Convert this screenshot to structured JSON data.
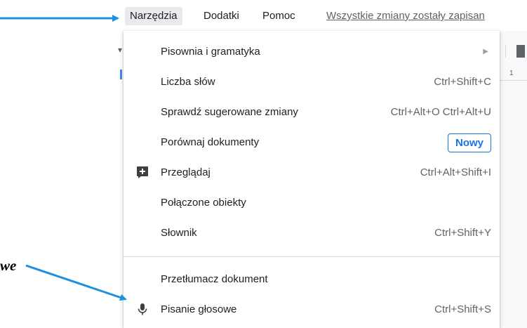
{
  "menubar": {
    "items": [
      {
        "label": "Narzędzia",
        "active": true
      },
      {
        "label": "Dodatki",
        "active": false
      },
      {
        "label": "Pomoc",
        "active": false
      }
    ],
    "save_status": "Wszystkie zmiany zostały zapisan"
  },
  "background": {
    "ruler_text": "1"
  },
  "dropdown": {
    "items": [
      {
        "label": "Pisownia i gramatyka",
        "shortcut": "",
        "submenu": true,
        "icon": ""
      },
      {
        "label": "Liczba słów",
        "shortcut": "Ctrl+Shift+C",
        "icon": ""
      },
      {
        "label": "Sprawdź sugerowane zmiany",
        "shortcut": "Ctrl+Alt+O Ctrl+Alt+U",
        "icon": ""
      },
      {
        "label": "Porównaj dokumenty",
        "badge": "Nowy",
        "icon": ""
      },
      {
        "label": "Przeglądaj",
        "shortcut": "Ctrl+Alt+Shift+I",
        "icon": "explore-plus-icon"
      },
      {
        "label": "Połączone obiekty",
        "shortcut": "",
        "icon": ""
      },
      {
        "label": "Słownik",
        "shortcut": "Ctrl+Shift+Y",
        "icon": ""
      },
      {
        "label": "Przetłumacz dokument",
        "shortcut": "",
        "icon": ""
      },
      {
        "label": "Pisanie głosowe",
        "shortcut": "Ctrl+Shift+S",
        "icon": "microphone-icon"
      }
    ]
  },
  "annotation": {
    "text": "we",
    "arrow_color": "#1e90e0"
  }
}
